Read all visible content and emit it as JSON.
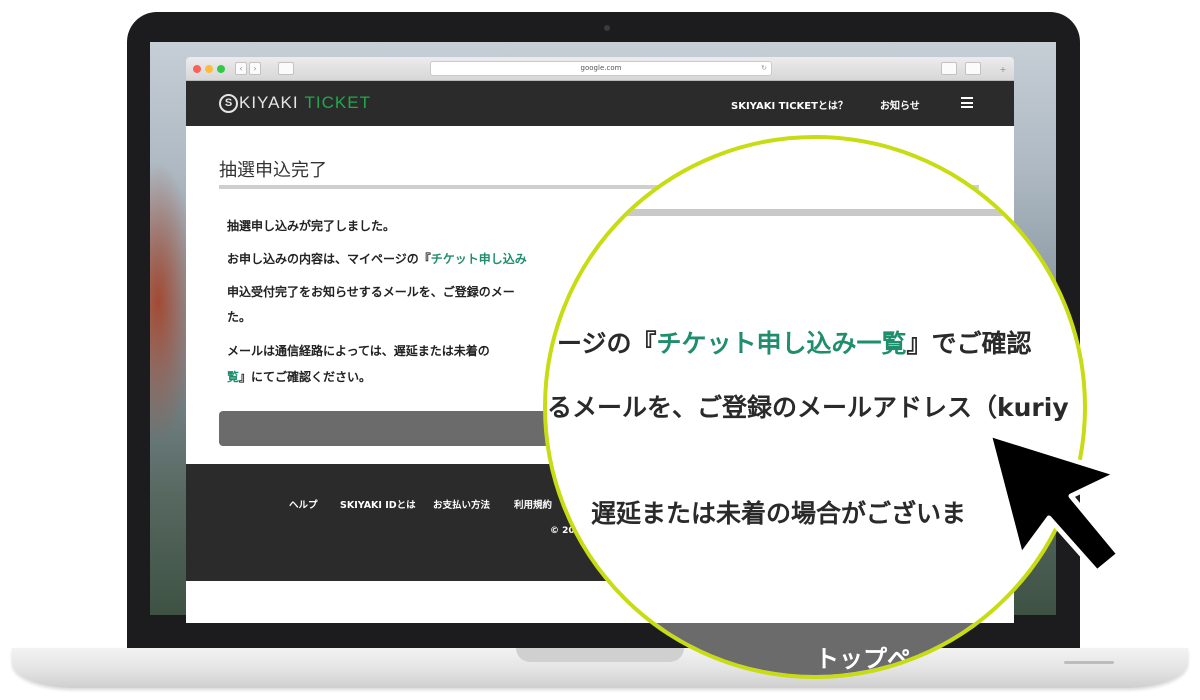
{
  "browser": {
    "url": "google.com",
    "back_glyph": "‹",
    "forward_glyph": "›"
  },
  "header": {
    "logo_mark": "S",
    "logo_text": "KIYAKI",
    "logo_ticket": "TICKET",
    "nav": [
      "SKIYAKI TICKETとは？",
      "お知らせ"
    ],
    "menu_icon": "hamburger-icon"
  },
  "main": {
    "title": "抽選申込完了",
    "lines": {
      "l1": "抽選申し込みが完了しました。",
      "l2_pre": "お申し込みの内容は、マイページの『",
      "l2_link": "チケット申し込み",
      "l3": "申込受付完了をお知らせするメールを、ご登録のメー",
      "l4": "た。",
      "l5": "メールは通信経路によっては、遅延または未着の",
      "l6_link": "覧",
      "l6_post": "』にてご確認ください。"
    }
  },
  "footer": {
    "links": [
      "ヘルプ",
      "SKIYAKI IDとは",
      "お支払い方法",
      "利用規約"
    ],
    "copyright": "© 20"
  },
  "magnifier": {
    "line1_pre": "ージの『",
    "line1_link": "チケット申し込み一覧",
    "line1_post": "』でご確認",
    "line2": "るメールを、ご登録のメールアドレス（kuriy",
    "line3": "遅延または未着の場合がございま",
    "bottom_label": "トップペ"
  },
  "colors": {
    "accent_green": "#20a94b",
    "link_green": "#1f8e6d",
    "magnifier_ring": "#c7dc12",
    "header_bg": "#2b2b2b"
  }
}
